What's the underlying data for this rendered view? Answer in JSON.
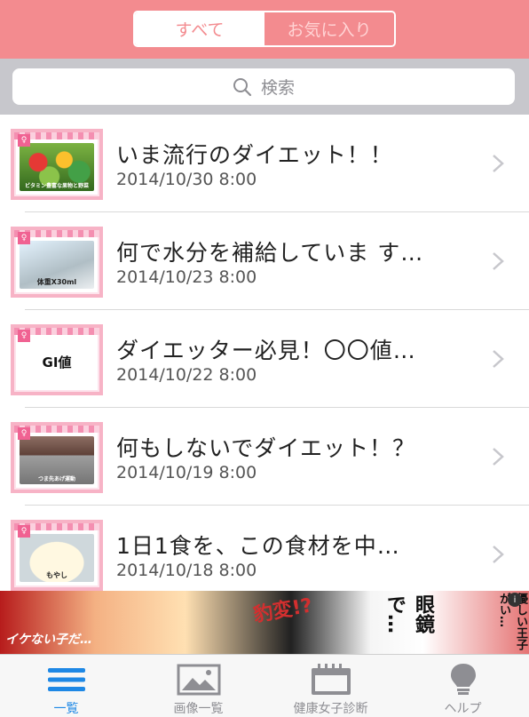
{
  "header": {
    "segments": [
      {
        "label": "すべて",
        "active": true
      },
      {
        "label": "お気に入り",
        "active": false
      }
    ],
    "background_color": "#f38b8f"
  },
  "search": {
    "placeholder": "検索",
    "icon": "search-icon"
  },
  "articles": [
    {
      "title": "いま流行のダイエット！！",
      "date": "2014/10/30 8:00",
      "thumb_caption": "ビタミン豊富な果物と野菜"
    },
    {
      "title": "何で水分を補給していま す…",
      "date": "2014/10/23 8:00",
      "thumb_caption": "体重X30ml"
    },
    {
      "title": "ダイエッター必見！〇〇値…",
      "date": "2014/10/22 8:00",
      "thumb_caption": "GI値"
    },
    {
      "title": "何もしないでダイエット！？",
      "date": "2014/10/19 8:00",
      "thumb_caption": "つま先あげ運動"
    },
    {
      "title": "1日1食を、この食材を中…",
      "date": "2014/10/18 8:00",
      "thumb_caption": "もやし"
    }
  ],
  "ad": {
    "texts": [
      "イケない子だ…",
      "豹変!?",
      "眼鏡で…",
      "優しい王子がい…"
    ]
  },
  "tabbar": {
    "tabs": [
      {
        "label": "一覧",
        "icon": "list-icon",
        "active": true
      },
      {
        "label": "画像一覧",
        "icon": "image-icon",
        "active": false
      },
      {
        "label": "健康女子診断",
        "icon": "calendar-icon",
        "active": false
      },
      {
        "label": "ヘルプ",
        "icon": "lightbulb-icon",
        "active": false
      }
    ],
    "active_color": "#1e88e5"
  }
}
